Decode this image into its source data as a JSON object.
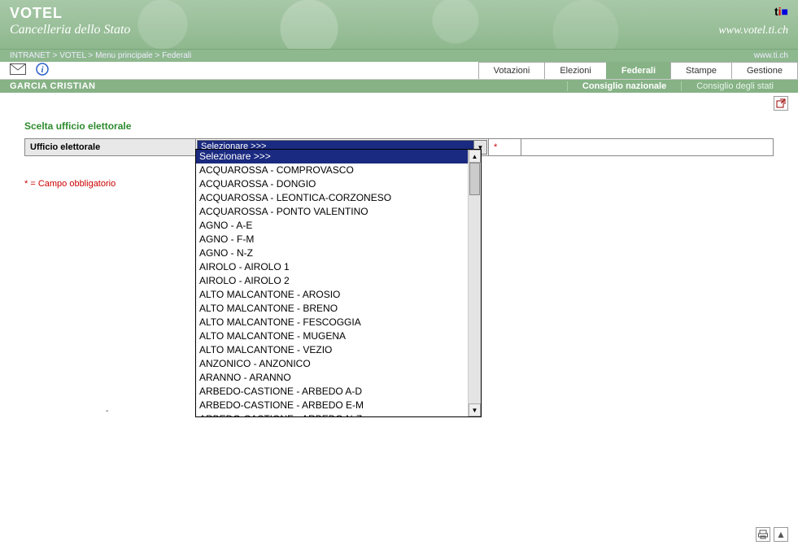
{
  "header": {
    "title": "VOTEL",
    "subtitle": "Cancelleria dello Stato",
    "url": "www.votel.ti.ch",
    "logo": "ti",
    "external_url": "www.ti.ch"
  },
  "breadcrumb": {
    "items": [
      "INTRANET",
      "VOTEL",
      "Menu principale",
      "Federali"
    ]
  },
  "tabs": {
    "items": [
      {
        "label": "Votazioni",
        "active": false
      },
      {
        "label": "Elezioni",
        "active": false
      },
      {
        "label": "Federali",
        "active": true
      },
      {
        "label": "Stampe",
        "active": false
      },
      {
        "label": "Gestione",
        "active": false
      }
    ]
  },
  "user": "GARCIA CRISTIAN",
  "subtabs": {
    "items": [
      {
        "label": "Consiglio nazionale",
        "active": true
      },
      {
        "label": "Consiglio degli stati",
        "active": false
      }
    ]
  },
  "form": {
    "section_title": "Scelta ufficio elettorale",
    "field_label": "Ufficio elettorale",
    "required_marker": "*",
    "selected_text": "Selezionare >>>",
    "mandatory_note": "* = Campo obbligatorio"
  },
  "dropdown": {
    "options": [
      "Selezionare >>>",
      "ACQUAROSSA - COMPROVASCO",
      "ACQUAROSSA - DONGIO",
      "ACQUAROSSA - LEONTICA-CORZONESO",
      "ACQUAROSSA - PONTO VALENTINO",
      "AGNO - A-E",
      "AGNO - F-M",
      "AGNO - N-Z",
      "AIROLO - AIROLO 1",
      "AIROLO - AIROLO 2",
      "ALTO MALCANTONE - AROSIO",
      "ALTO MALCANTONE - BRENO",
      "ALTO MALCANTONE - FESCOGGIA",
      "ALTO MALCANTONE - MUGENA",
      "ALTO MALCANTONE - VEZIO",
      "ANZONICO - ANZONICO",
      "ARANNO - ARANNO",
      "ARBEDO-CASTIONE - ARBEDO A-D",
      "ARBEDO-CASTIONE - ARBEDO E-M",
      "ARBEDO-CASTIONE - ARBEDO N-Z"
    ],
    "selected_index": 0
  }
}
